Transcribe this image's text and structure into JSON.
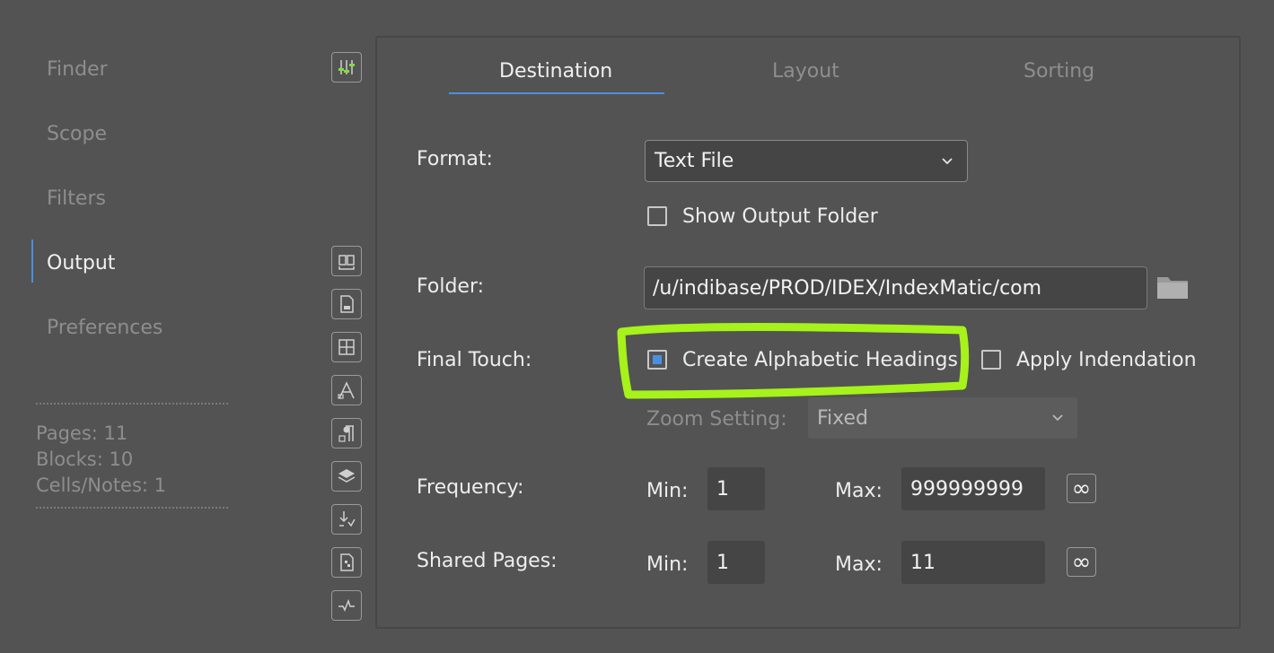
{
  "sidebar": {
    "items": [
      {
        "label": "Finder"
      },
      {
        "label": "Scope"
      },
      {
        "label": "Filters"
      },
      {
        "label": "Output"
      },
      {
        "label": "Preferences"
      }
    ],
    "active": "Output",
    "stats": {
      "pages": "Pages: 11",
      "blocks": "Blocks: 10",
      "cells": "Cells/Notes: 1"
    }
  },
  "toolbar": {
    "icons": [
      "sliders-icon",
      "book-icon",
      "document-icon",
      "grid-icon",
      "type-icon",
      "paragraph-icon",
      "layers-icon",
      "import-icon",
      "report-icon",
      "chart-icon"
    ]
  },
  "tabs": [
    {
      "label": "Destination"
    },
    {
      "label": "Layout"
    },
    {
      "label": "Sorting"
    }
  ],
  "form": {
    "format_label": "Format:",
    "format_value": "Text File",
    "show_output_folder": "Show Output Folder",
    "folder_label": "Folder:",
    "folder_value": "/u/indibase/PROD/IDEX/IndexMatic/com",
    "final_touch_label": "Final Touch:",
    "create_headings": "Create Alphabetic Headings",
    "apply_indentation": "Apply Indendation",
    "zoom_label": "Zoom Setting:",
    "zoom_value": "Fixed",
    "frequency_label": "Frequency:",
    "shared_pages_label": "Shared Pages:",
    "min_label": "Min:",
    "max_label": "Max:",
    "frequency_min": "1",
    "frequency_max": "999999999",
    "shared_min": "1",
    "shared_max": "11",
    "infinity": "∞"
  },
  "colors": {
    "background": "#535353",
    "accent": "#4a90e2",
    "highlight": "#a6f21a"
  }
}
